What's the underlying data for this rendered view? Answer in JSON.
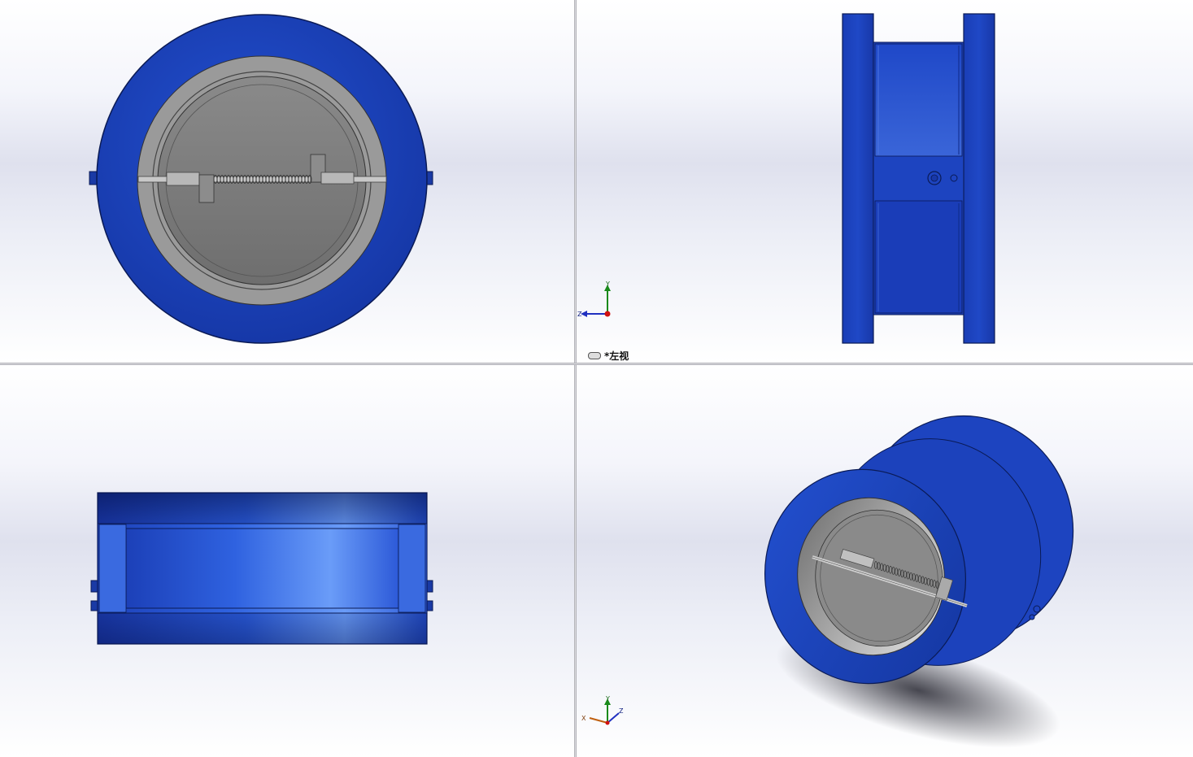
{
  "views": {
    "front": {
      "name": "front"
    },
    "left": {
      "name": "left",
      "label": "*左视"
    },
    "top": {
      "name": "top"
    },
    "isometric": {
      "name": "isometric"
    }
  },
  "triad": {
    "x": "X",
    "y": "Y",
    "z": "Z"
  },
  "colors": {
    "body_blue": "#1d3fb0",
    "body_blue_dark": "#102a80",
    "body_blue_light": "#5b8ff5",
    "disc_gray": "#7a7a7a",
    "bore_gray": "#9c9c9c"
  }
}
